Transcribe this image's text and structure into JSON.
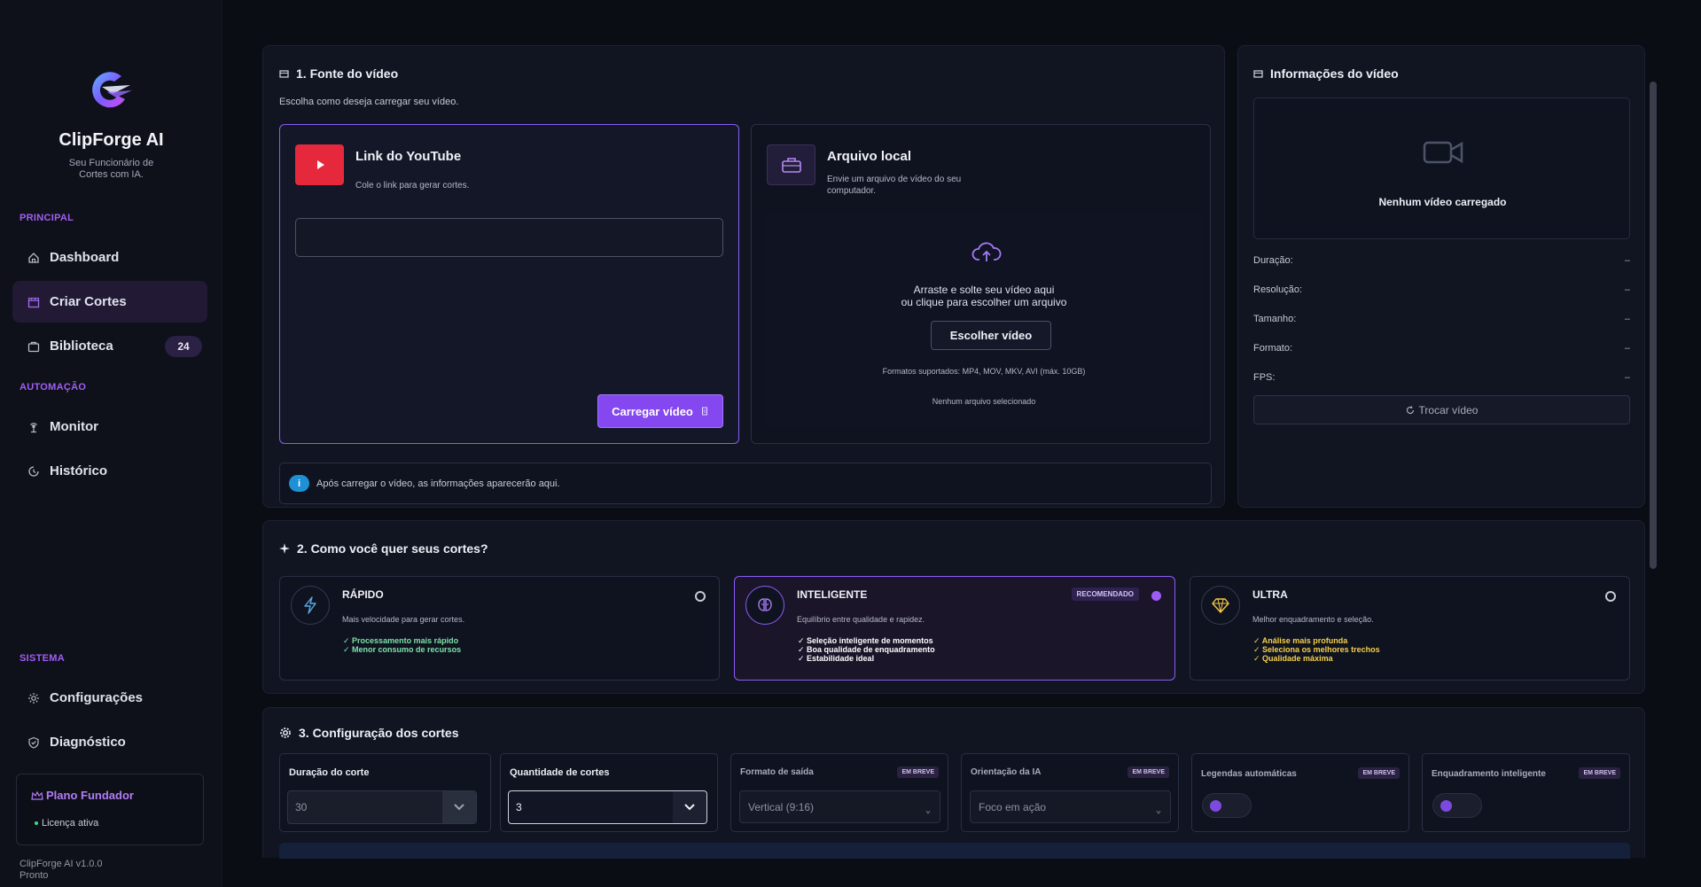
{
  "sidebar": {
    "brand": "ClipForge AI",
    "tagline": "Seu Funcionário de Cortes com IA.",
    "sections": {
      "principal": "PRINCIPAL",
      "automacao": "AUTOMAÇÃO",
      "sistema": "SISTEMA"
    },
    "items": [
      {
        "label": "Dashboard",
        "icon": "home-icon"
      },
      {
        "label": "Criar Cortes",
        "icon": "clapper-icon",
        "active": true
      },
      {
        "label": "Biblioteca",
        "icon": "folder-icon",
        "badge": "24"
      },
      {
        "label": "Monitor",
        "icon": "antenna-icon"
      },
      {
        "label": "Histórico",
        "icon": "history-icon"
      },
      {
        "label": "Configurações",
        "icon": "gear-icon"
      },
      {
        "label": "Diagnóstico",
        "icon": "shield-icon"
      }
    ],
    "plan": {
      "title": "Plano Fundador",
      "status": "Licença ativa"
    },
    "version": "ClipForge AI v1.0.0",
    "state": "Pronto"
  },
  "source": {
    "title": "1. Fonte do vídeo",
    "subtitle": "Escolha como deseja carregar seu vídeo.",
    "youtube": {
      "title": "Link do YouTube",
      "desc": "Cole o link para gerar cortes.",
      "input_value": "",
      "button": "Carregar vídeo"
    },
    "local": {
      "title": "Arquivo local",
      "desc": "Envie um arquivo de vídeo do seu computador.",
      "drop_line1": "Arraste e solte seu vídeo aqui",
      "drop_line2": "ou clique para escolher um arquivo",
      "button": "Escolher vídeo",
      "formats": "Formatos suportados: MP4, MOV, MKV, AVI (máx. 10GB)",
      "selected": "Nenhum arquivo selecionado"
    },
    "notice": "Após carregar o vídeo, as informações aparecerão aqui."
  },
  "info": {
    "title": "Informações do vídeo",
    "empty": "Nenhum vídeo carregado",
    "rows": [
      {
        "label": "Duração:",
        "value": "–"
      },
      {
        "label": "Resolução:",
        "value": "–"
      },
      {
        "label": "Tamanho:",
        "value": "–"
      },
      {
        "label": "Formato:",
        "value": "–"
      },
      {
        "label": "FPS:",
        "value": "–"
      }
    ],
    "button": "Trocar vídeo"
  },
  "modes": {
    "title": "2. Como você quer seus cortes?",
    "items": [
      {
        "name": "RÁPIDO",
        "desc": "Mais velocidade para gerar cortes.",
        "features": [
          "✓  Processamento mais rápido",
          "✓  Menor consumo de recursos"
        ],
        "color": "#7ee2a8"
      },
      {
        "name": "INTELIGENTE",
        "desc": "Equilíbrio entre qualidade e rapidez.",
        "badge": "RECOMENDADO",
        "features": [
          "✓  Seleção inteligente de momentos",
          "✓  Boa qualidade de enquadramento",
          "✓  Estabilidade ideal"
        ],
        "color": "#ffffff"
      },
      {
        "name": "ULTRA",
        "desc": "Melhor enquadramento e seleção.",
        "features": [
          "✓  Análise mais profunda",
          "✓  Seleciona os melhores trechos",
          "✓  Qualidade máxima"
        ],
        "color": "#f5d04a"
      }
    ]
  },
  "config": {
    "title": "3. Configuração dos cortes",
    "duration": {
      "label": "Duração do corte",
      "value": "30"
    },
    "count": {
      "label": "Quantidade de cortes",
      "value": "3"
    },
    "format": {
      "label": "Formato de saída",
      "badge": "EM BREVE",
      "value": "Vertical (9:16)"
    },
    "orientation": {
      "label": "Orientação da IA",
      "badge": "EM BREVE",
      "value": "Foco em ação"
    },
    "captions": {
      "label": "Legendas automáticas",
      "badge": "EM BREVE"
    },
    "framing": {
      "label": "Enquadramento inteligente",
      "badge": "EM BREVE"
    }
  }
}
